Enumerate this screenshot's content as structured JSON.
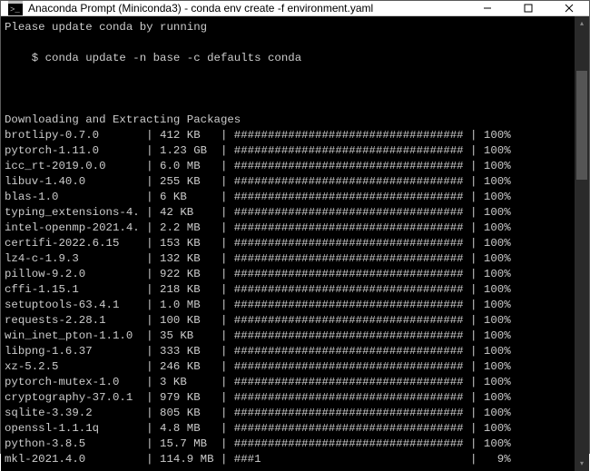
{
  "window": {
    "title": "Anaconda Prompt (Miniconda3) - conda  env create -f environment.yaml"
  },
  "messages": {
    "update_notice": "Please update conda by running",
    "update_cmd": "    $ conda update -n base -c defaults conda",
    "section_header": "Downloading and Extracting Packages"
  },
  "bar_full": "##################################",
  "packages": [
    {
      "name": "brotlipy-0.7.0",
      "size": "412 KB",
      "bar": "##################################",
      "pct": "100%"
    },
    {
      "name": "pytorch-1.11.0",
      "size": "1.23 GB",
      "bar": "##################################",
      "pct": "100%"
    },
    {
      "name": "icc_rt-2019.0.0",
      "size": "6.0 MB",
      "bar": "##################################",
      "pct": "100%"
    },
    {
      "name": "libuv-1.40.0",
      "size": "255 KB",
      "bar": "##################################",
      "pct": "100%"
    },
    {
      "name": "blas-1.0",
      "size": "6 KB",
      "bar": "##################################",
      "pct": "100%"
    },
    {
      "name": "typing_extensions-4.",
      "size": "42 KB",
      "bar": "##################################",
      "pct": "100%"
    },
    {
      "name": "intel-openmp-2021.4.",
      "size": "2.2 MB",
      "bar": "##################################",
      "pct": "100%"
    },
    {
      "name": "certifi-2022.6.15",
      "size": "153 KB",
      "bar": "##################################",
      "pct": "100%"
    },
    {
      "name": "lz4-c-1.9.3",
      "size": "132 KB",
      "bar": "##################################",
      "pct": "100%"
    },
    {
      "name": "pillow-9.2.0",
      "size": "922 KB",
      "bar": "##################################",
      "pct": "100%"
    },
    {
      "name": "cffi-1.15.1",
      "size": "218 KB",
      "bar": "##################################",
      "pct": "100%"
    },
    {
      "name": "setuptools-63.4.1",
      "size": "1.0 MB",
      "bar": "##################################",
      "pct": "100%"
    },
    {
      "name": "requests-2.28.1",
      "size": "100 KB",
      "bar": "##################################",
      "pct": "100%"
    },
    {
      "name": "win_inet_pton-1.1.0",
      "size": "35 KB",
      "bar": "##################################",
      "pct": "100%"
    },
    {
      "name": "libpng-1.6.37",
      "size": "333 KB",
      "bar": "##################################",
      "pct": "100%"
    },
    {
      "name": "xz-5.2.5",
      "size": "246 KB",
      "bar": "##################################",
      "pct": "100%"
    },
    {
      "name": "pytorch-mutex-1.0",
      "size": "3 KB",
      "bar": "##################################",
      "pct": "100%"
    },
    {
      "name": "cryptography-37.0.1",
      "size": "979 KB",
      "bar": "##################################",
      "pct": "100%"
    },
    {
      "name": "sqlite-3.39.2",
      "size": "805 KB",
      "bar": "##################################",
      "pct": "100%"
    },
    {
      "name": "openssl-1.1.1q",
      "size": "4.8 MB",
      "bar": "##################################",
      "pct": "100%"
    },
    {
      "name": "python-3.8.5",
      "size": "15.7 MB",
      "bar": "##################################",
      "pct": "100%"
    },
    {
      "name": "mkl-2021.4.0",
      "size": "114.9 MB",
      "bar": "###1                              ",
      "pct": "9%"
    }
  ]
}
